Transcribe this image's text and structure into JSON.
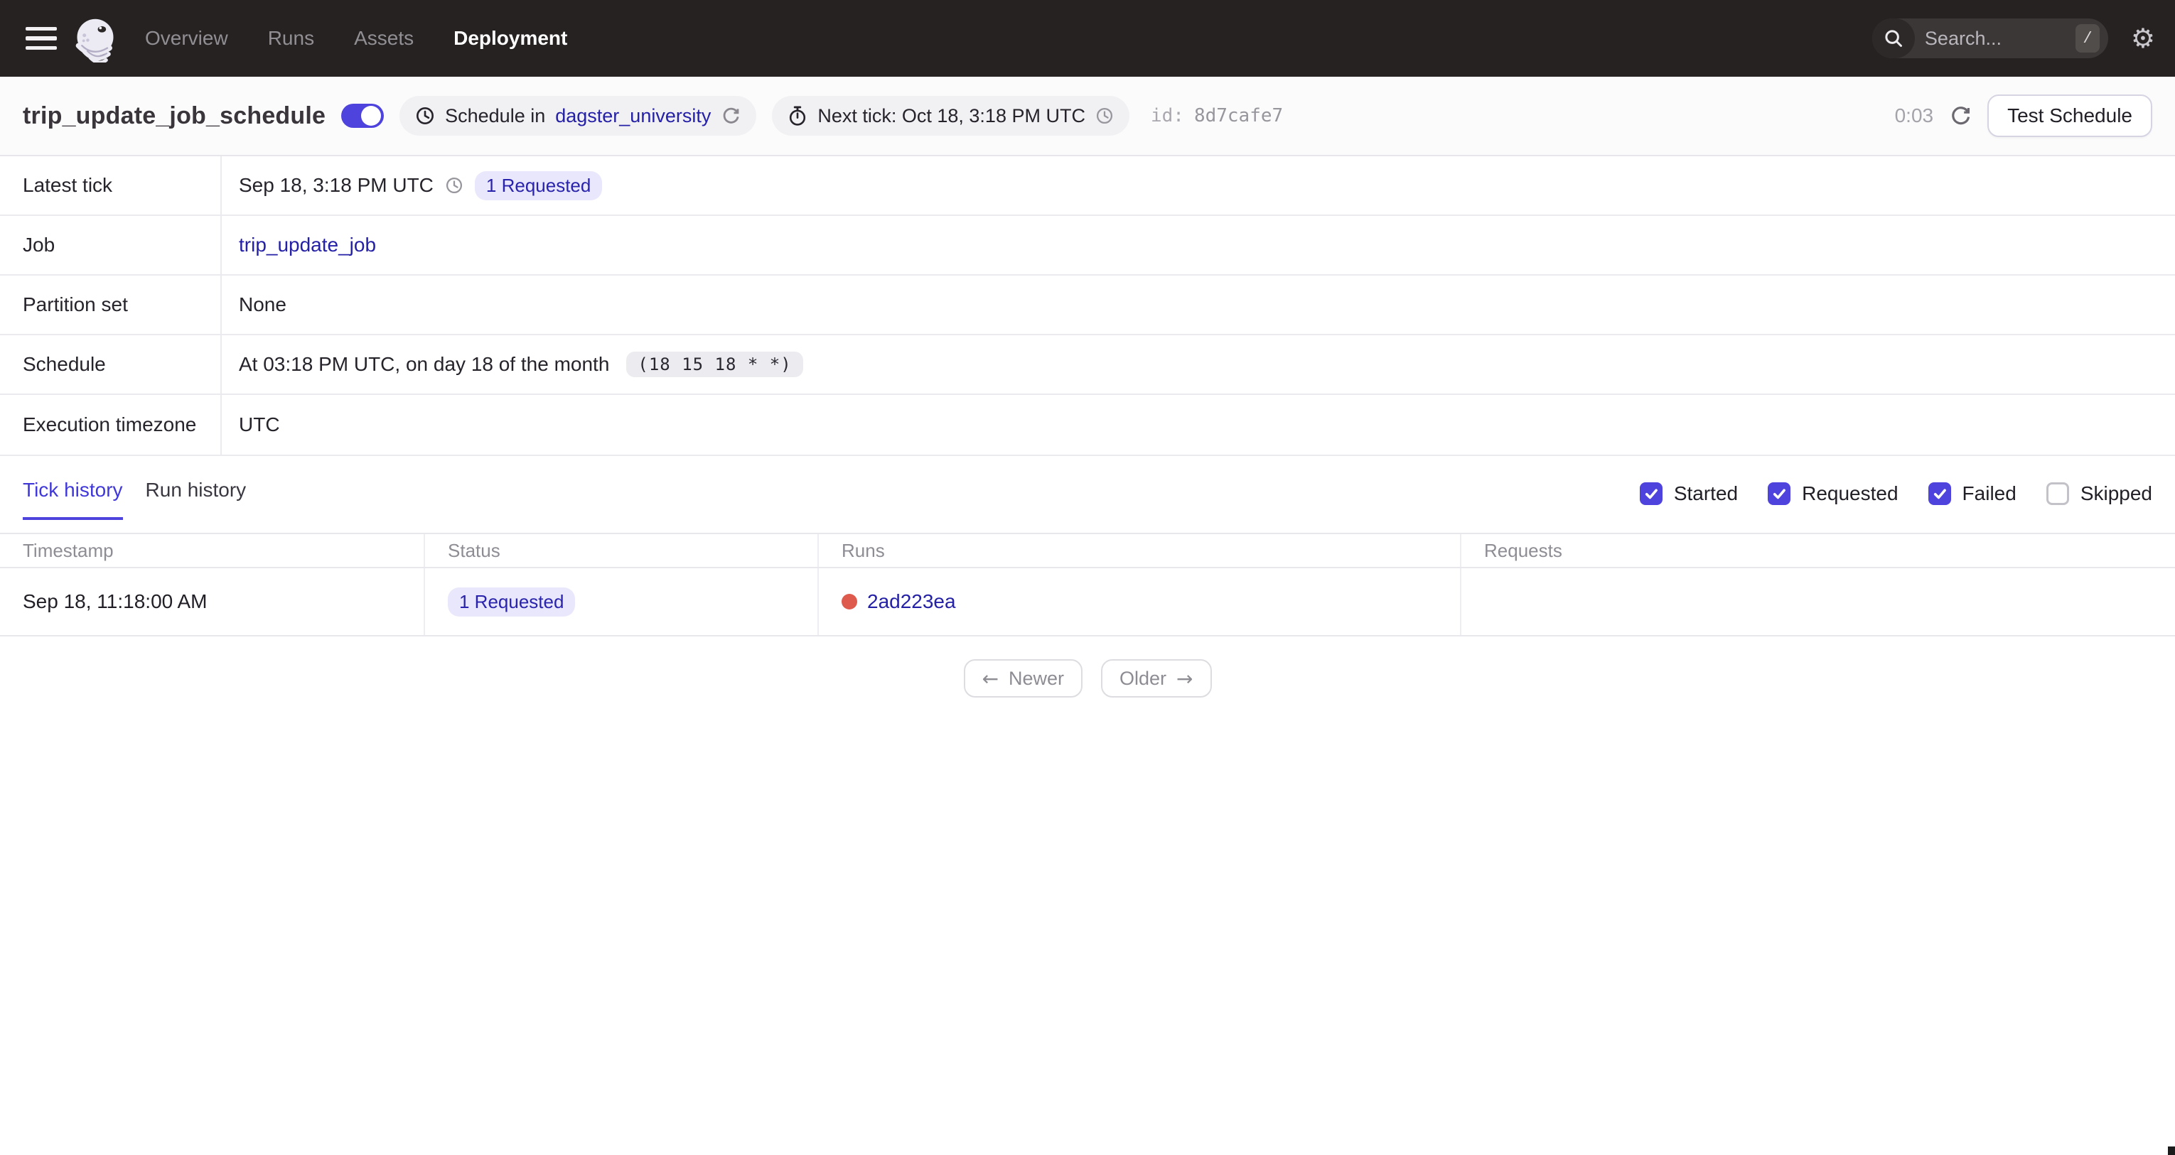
{
  "nav": {
    "items": [
      {
        "label": "Overview",
        "active": false
      },
      {
        "label": "Runs",
        "active": false
      },
      {
        "label": "Assets",
        "active": false
      },
      {
        "label": "Deployment",
        "active": true
      }
    ],
    "search": {
      "placeholder": "Search...",
      "shortcut": "/"
    }
  },
  "header": {
    "title": "trip_update_job_schedule",
    "toggle_on": true,
    "schedule_pill": {
      "prefix": "Schedule in",
      "location": "dagster_university"
    },
    "next_tick_pill": {
      "text": "Next tick: Oct 18, 3:18 PM UTC"
    },
    "id_label": "id:",
    "id_value": "8d7cafe7",
    "refresh_timer": "0:03",
    "test_button": "Test Schedule"
  },
  "details": {
    "latest_tick": {
      "label": "Latest tick",
      "time": "Sep 18, 3:18 PM UTC",
      "badge": "1 Requested"
    },
    "job": {
      "label": "Job",
      "link": "trip_update_job"
    },
    "partition_set": {
      "label": "Partition set",
      "value": "None"
    },
    "schedule": {
      "label": "Schedule",
      "description": "At 03:18 PM UTC, on day 18 of the month",
      "cron": "(18 15 18 * *)"
    },
    "timezone": {
      "label": "Execution timezone",
      "value": "UTC"
    }
  },
  "tabs": [
    {
      "label": "Tick history",
      "active": true
    },
    {
      "label": "Run history",
      "active": false
    }
  ],
  "filters": [
    {
      "label": "Started",
      "checked": true
    },
    {
      "label": "Requested",
      "checked": true
    },
    {
      "label": "Failed",
      "checked": true
    },
    {
      "label": "Skipped",
      "checked": false
    }
  ],
  "tick_table": {
    "columns": [
      "Timestamp",
      "Status",
      "Runs",
      "Requests"
    ],
    "rows": [
      {
        "timestamp": "Sep 18, 11:18:00 AM",
        "status_badge": "1 Requested",
        "run_id": "2ad223ea",
        "requests": ""
      }
    ]
  },
  "pagination": {
    "newer": "Newer",
    "older": "Older",
    "newer_arrow": "←",
    "older_arrow": "→"
  },
  "colors": {
    "accent": "#4F43DD",
    "link": "#2521A6",
    "badge_bg": "#E9E7FB",
    "run_failed_dot": "#DE5A4C",
    "nav_bg": "#262222",
    "titlebar_bg": "#FBFBFB"
  }
}
